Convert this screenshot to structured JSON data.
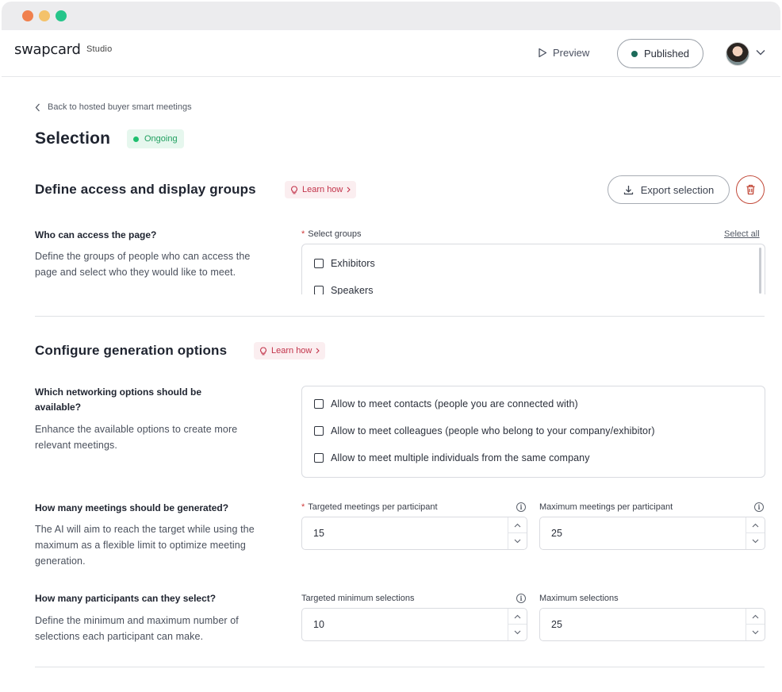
{
  "app": {
    "brand": "swapcard",
    "product": "Studio",
    "preview_label": "Preview",
    "published_label": "Published"
  },
  "page": {
    "back_label": "Back to hosted buyer smart meetings",
    "title": "Selection",
    "status": "Ongoing"
  },
  "access": {
    "title": "Define access and display groups",
    "learn_label": "Learn how",
    "export_label": "Export selection",
    "question": "Who can access the page?",
    "description": "Define the groups of people who can access the page and select who they would like to meet.",
    "field_label": "Select groups",
    "select_all": "Select all",
    "groups": [
      "Exhibitors",
      "Speakers"
    ]
  },
  "generation": {
    "title": "Configure generation options",
    "learn_label": "Learn how",
    "networking": {
      "question": "Which networking options should be available?",
      "description": "Enhance the available options to create more relevant meetings.",
      "options": [
        "Allow to meet contacts (people you are connected with)",
        "Allow to meet colleagues (people who belong to your company/exhibitor)",
        "Allow to meet multiple individuals from the same company"
      ]
    },
    "meetings": {
      "question": "How many meetings should be generated?",
      "description": "The AI will aim to reach the target while using the maximum as a flexible limit to optimize meeting generation.",
      "target_label": "Targeted meetings per participant",
      "target_value": "15",
      "max_label": "Maximum meetings per participant",
      "max_value": "25"
    },
    "selections": {
      "question": "How many participants can they select?",
      "description": "Define the minimum and maximum number of selections each participant can make.",
      "min_label": "Targeted minimum selections",
      "min_value": "10",
      "max_label": "Maximum selections",
      "max_value": "25"
    }
  }
}
